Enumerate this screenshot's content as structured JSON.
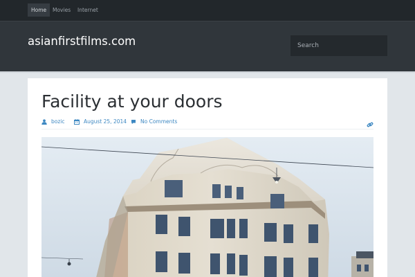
{
  "nav": {
    "items": [
      {
        "label": "Home",
        "active": true
      },
      {
        "label": "Movies",
        "active": false
      },
      {
        "label": "Internet",
        "active": false
      }
    ]
  },
  "header": {
    "site_title": "asianfirstfilms.com",
    "search_placeholder": "Search"
  },
  "post": {
    "title": "Facility at your doors",
    "author": "bozic",
    "date": "August 25, 2014",
    "comments": "No Comments"
  },
  "colors": {
    "accent": "#3d88c2",
    "topbar": "#22272b",
    "header": "#30363b",
    "page_bg": "#e1e6ea"
  },
  "icons": [
    "user-icon",
    "calendar-icon",
    "comment-icon",
    "link-icon"
  ]
}
